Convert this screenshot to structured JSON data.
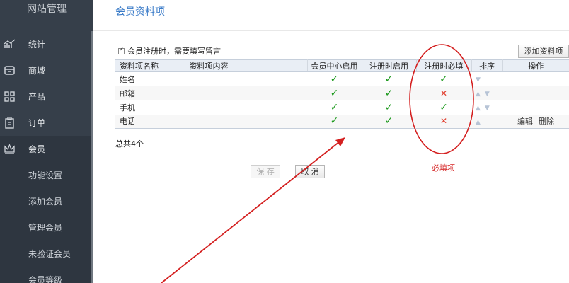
{
  "sidebar": {
    "title": "网站管理",
    "items": [
      {
        "label": "统计",
        "icon": "chart-icon"
      },
      {
        "label": "商城",
        "icon": "store-icon"
      },
      {
        "label": "产品",
        "icon": "grid-icon"
      },
      {
        "label": "订单",
        "icon": "clipboard-icon"
      },
      {
        "label": "会员",
        "icon": "crown-icon"
      }
    ],
    "sub_items": [
      "功能设置",
      "添加会员",
      "管理会员",
      "未验证会员",
      "会员等级"
    ]
  },
  "main": {
    "title": "会员资料项",
    "option_label": "会员注册时，需要填写留言",
    "add_button": "添加资料项",
    "columns": [
      "资料项名称",
      "资料项内容",
      "会员中心启用",
      "注册时启用",
      "注册时必填",
      "排序",
      "操作"
    ],
    "rows": [
      {
        "name": "姓名",
        "center": "✓",
        "register": "✓",
        "required": "✓",
        "required_state": "yes"
      },
      {
        "name": "邮箱",
        "center": "✓",
        "register": "✓",
        "required": "✕",
        "required_state": "no"
      },
      {
        "name": "手机",
        "center": "✓",
        "register": "✓",
        "required": "✓",
        "required_state": "yes"
      },
      {
        "name": "电话",
        "center": "✓",
        "register": "✓",
        "required": "✕",
        "required_state": "no"
      }
    ],
    "actions": {
      "edit": "编辑",
      "delete": "删除"
    },
    "total": "总共4个",
    "save_button": "保 存",
    "cancel_button": "取 消"
  },
  "annotation": {
    "note": "必填项",
    "color": "#d42020"
  }
}
